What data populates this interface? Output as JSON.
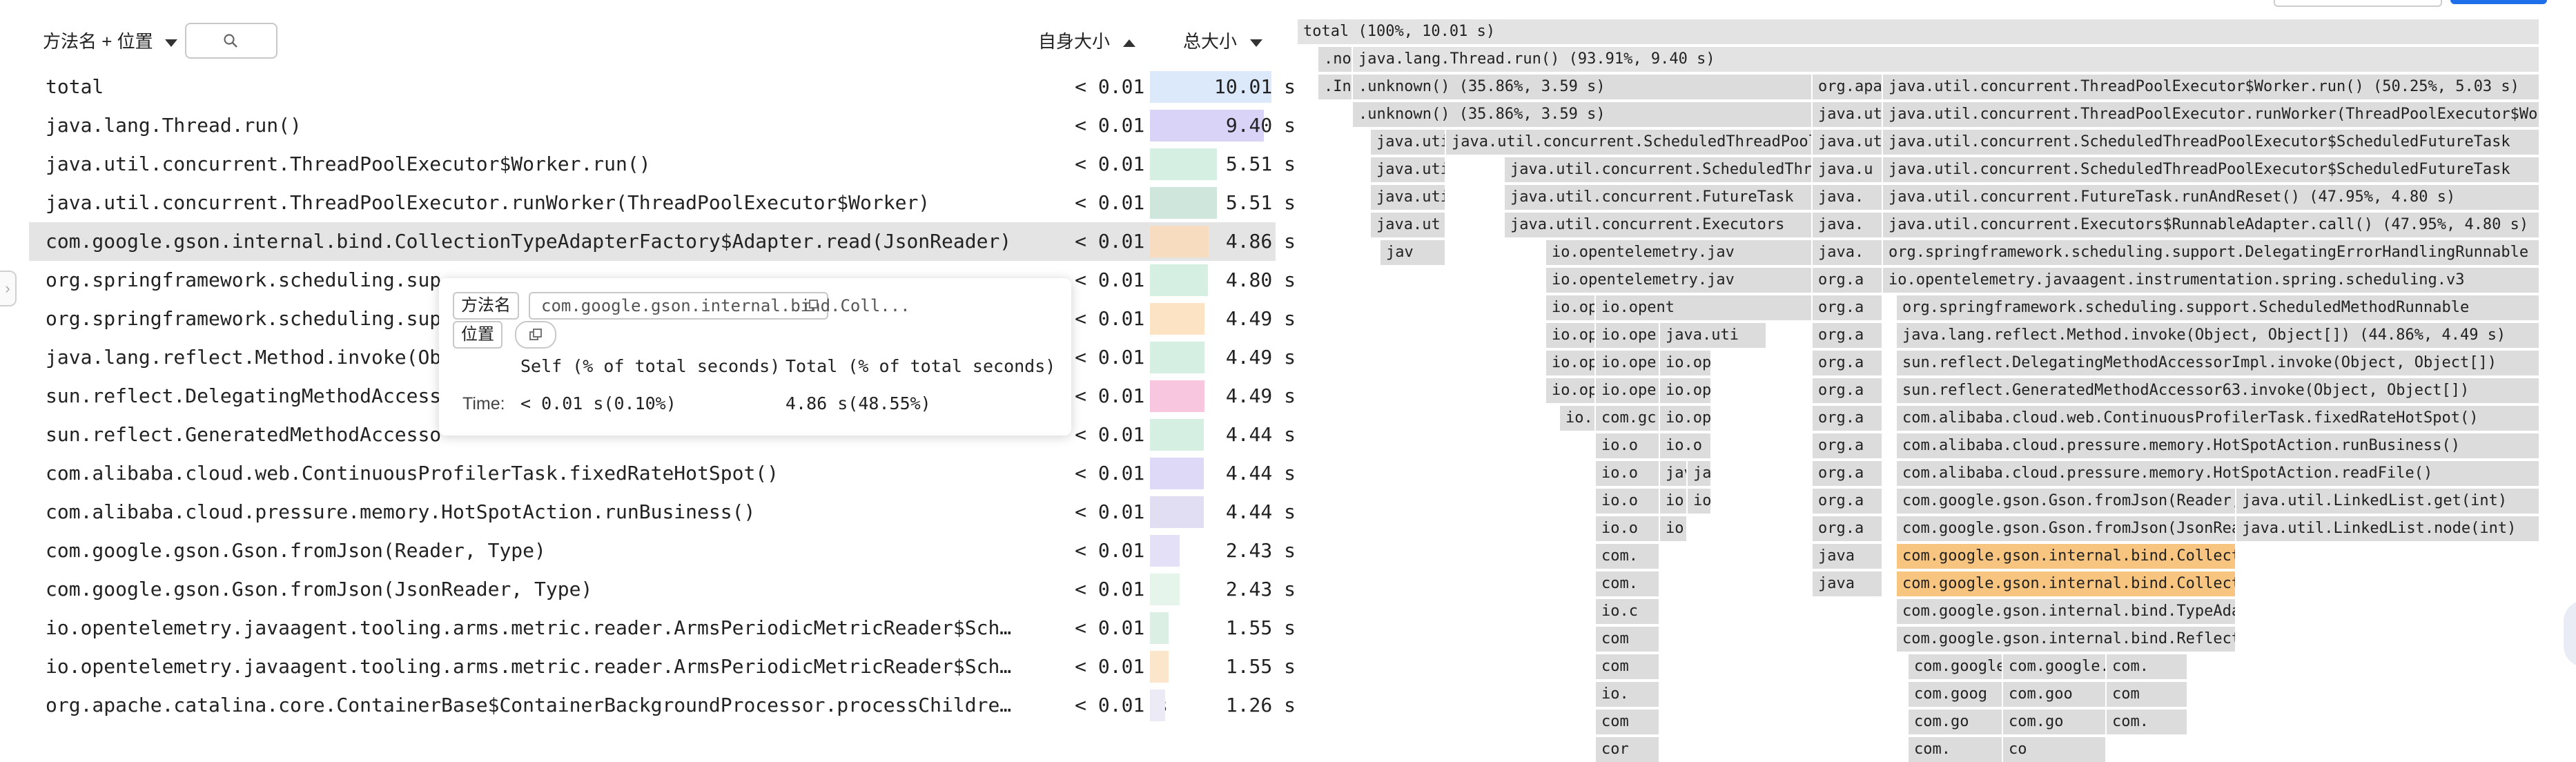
{
  "header": {
    "method_col_label": "方法名 + 位置",
    "self_col_label": "自身大小",
    "total_col_label": "总大小"
  },
  "rows": [
    {
      "name": "total",
      "self": "< 0.01 s",
      "total": "10.01 s",
      "bar_color": "#dbe9fb",
      "fraction": 1.0
    },
    {
      "name": "java.lang.Thread.run()",
      "self": "< 0.01 s",
      "total": "9.40 s",
      "bar_color": "#d9d4f7",
      "fraction": 0.939
    },
    {
      "name": "java.util.concurrent.ThreadPoolExecutor$Worker.run()",
      "self": "< 0.01 s",
      "total": "5.51 s",
      "bar_color": "#d6efe3",
      "fraction": 0.55
    },
    {
      "name": "java.util.concurrent.ThreadPoolExecutor.runWorker(ThreadPoolExecutor$Worker)",
      "self": "< 0.01 s",
      "total": "5.51 s",
      "bar_color": "#cfe6dc",
      "fraction": 0.55
    },
    {
      "name": "com.google.gson.internal.bind.CollectionTypeAdapterFactory$Adapter.read(JsonReader)",
      "self": "< 0.01 s",
      "total": "4.86 s",
      "bar_color": "#f7dcc0",
      "fraction": 0.4855
    },
    {
      "name": "org.springframework.scheduling.sup",
      "self": "< 0.01 s",
      "total": "4.80 s",
      "bar_color": "#d6efe3",
      "fraction": 0.48
    },
    {
      "name": "org.springframework.scheduling.sup",
      "self": "< 0.01 s",
      "total": "4.49 s",
      "bar_color": "#fbe3c4",
      "fraction": 0.449
    },
    {
      "name": "java.lang.reflect.Method.invoke(Ob",
      "self": "< 0.01 s",
      "total": "4.49 s",
      "bar_color": "#d6efe3",
      "fraction": 0.449
    },
    {
      "name": "sun.reflect.DelegatingMethodAccess",
      "self": "< 0.01 s",
      "total": "4.49 s",
      "bar_color": "#f9c6df",
      "fraction": 0.449
    },
    {
      "name": "sun.reflect.GeneratedMethodAccesso",
      "self": "< 0.01 s",
      "total": "4.44 s",
      "bar_color": "#d6efe3",
      "fraction": 0.444
    },
    {
      "name": "com.alibaba.cloud.web.ContinuousProfilerTask.fixedRateHotSpot()",
      "self": "< 0.01 s",
      "total": "4.44 s",
      "bar_color": "#ddd9f7",
      "fraction": 0.444
    },
    {
      "name": "com.alibaba.cloud.pressure.memory.HotSpotAction.runBusiness()",
      "self": "< 0.01 s",
      "total": "4.44 s",
      "bar_color": "#e1def3",
      "fraction": 0.444
    },
    {
      "name": "com.google.gson.Gson.fromJson(Reader, Type)",
      "self": "< 0.01 s",
      "total": "2.43 s",
      "bar_color": "#e4e0f7",
      "fraction": 0.243
    },
    {
      "name": "com.google.gson.Gson.fromJson(JsonReader, Type)",
      "self": "< 0.01 s",
      "total": "2.43 s",
      "bar_color": "#e6f5ec",
      "fraction": 0.243
    },
    {
      "name": "io.opentelemetry.javaagent.tooling.arms.metric.reader.ArmsPeriodicMetricReader$Sch…",
      "self": "< 0.01 s",
      "total": "1.55 s",
      "bar_color": "#dbefe4",
      "fraction": 0.155
    },
    {
      "name": "io.opentelemetry.javaagent.tooling.arms.metric.reader.ArmsPeriodicMetricReader$Sch…",
      "self": "< 0.01 s",
      "total": "1.55 s",
      "bar_color": "#fbe6cc",
      "fraction": 0.155
    },
    {
      "name": "org.apache.catalina.core.ContainerBase$ContainerBackgroundProcessor.processChildre…",
      "self": "< 0.01 s",
      "total": "1.26 s",
      "bar_color": "#ecebf5",
      "fraction": 0.126
    }
  ],
  "tooltip": {
    "method_tag": "方法名",
    "method_value": "com.google.gson.internal.bind.Coll...",
    "location_tag": "位置",
    "col_self": "Self (% of total seconds)",
    "col_total": "Total (% of total seconds)",
    "row_label": "Time:",
    "self_value": "< 0.01 s(0.10%)",
    "total_value": "4.86 s(48.55%)"
  },
  "flame": {
    "frames": [
      {
        "l": 0,
        "r": 1800,
        "row": 0,
        "label": "total (100%, 10.01 s)",
        "c": "#e3e3e3"
      },
      {
        "l": 30,
        "r": 80,
        "row": 1,
        "label": ".no",
        "c": "#dcdcdc"
      },
      {
        "l": 80,
        "r": 1800,
        "row": 1,
        "label": "java.lang.Thread.run() (93.91%, 9.40 s)",
        "c": "#e3e3e3"
      },
      {
        "l": 30,
        "r": 80,
        "row": 2,
        "label": ".In",
        "c": "#dcdcdc"
      },
      {
        "l": 80,
        "r": 746,
        "row": 2,
        "label": ".unknown() (35.86%, 3.59 s)",
        "c": "#dcdcdc"
      },
      {
        "l": 746,
        "r": 848,
        "row": 2,
        "label": "org.apa",
        "c": "#dcdcdc"
      },
      {
        "l": 848,
        "r": 1800,
        "row": 2,
        "label": "java.util.concurrent.ThreadPoolExecutor$Worker.run() (50.25%, 5.03 s)",
        "c": "#dcdcdc"
      },
      {
        "l": 80,
        "r": 746,
        "row": 3,
        "label": ".unknown() (35.86%, 3.59 s)",
        "c": "#dcdcdc"
      },
      {
        "l": 746,
        "r": 848,
        "row": 3,
        "label": "java.ut",
        "c": "#dcdcdc"
      },
      {
        "l": 848,
        "r": 1800,
        "row": 3,
        "label": "java.util.concurrent.ThreadPoolExecutor.runWorker(ThreadPoolExecutor$Worker)",
        "c": "#dcdcdc"
      },
      {
        "l": 106,
        "r": 215,
        "row": 4,
        "label": "java.uti",
        "c": "#dcdcdc"
      },
      {
        "l": 215,
        "r": 746,
        "row": 4,
        "label": "java.util.concurrent.ScheduledThreadPoolExecutor",
        "c": "#dcdcdc"
      },
      {
        "l": 746,
        "r": 848,
        "row": 4,
        "label": "java.ut",
        "c": "#dcdcdc"
      },
      {
        "l": 848,
        "r": 1800,
        "row": 4,
        "label": "java.util.concurrent.ScheduledThreadPoolExecutor$ScheduledFutureTask",
        "c": "#dcdcdc"
      },
      {
        "l": 106,
        "r": 215,
        "row": 5,
        "label": "java.uti",
        "c": "#dcdcdc"
      },
      {
        "l": 300,
        "r": 746,
        "row": 5,
        "label": "java.util.concurrent.ScheduledThread",
        "c": "#dcdcdc"
      },
      {
        "l": 746,
        "r": 848,
        "row": 5,
        "label": "java.u",
        "c": "#dcdcdc"
      },
      {
        "l": 848,
        "r": 1800,
        "row": 5,
        "label": "java.util.concurrent.ScheduledThreadPoolExecutor$ScheduledFutureTask",
        "c": "#dcdcdc"
      },
      {
        "l": 106,
        "r": 215,
        "row": 6,
        "label": "java.uti",
        "c": "#dcdcdc"
      },
      {
        "l": 300,
        "r": 746,
        "row": 6,
        "label": "java.util.concurrent.FutureTask",
        "c": "#dcdcdc"
      },
      {
        "l": 746,
        "r": 848,
        "row": 6,
        "label": "java.",
        "c": "#dcdcdc"
      },
      {
        "l": 848,
        "r": 1800,
        "row": 6,
        "label": "java.util.concurrent.FutureTask.runAndReset() (47.95%, 4.80 s)",
        "c": "#dcdcdc"
      },
      {
        "l": 106,
        "r": 215,
        "row": 7,
        "label": "java.ut",
        "c": "#dcdcdc"
      },
      {
        "l": 300,
        "r": 746,
        "row": 7,
        "label": "java.util.concurrent.Executors",
        "c": "#dcdcdc"
      },
      {
        "l": 746,
        "r": 848,
        "row": 7,
        "label": "java.",
        "c": "#dcdcdc"
      },
      {
        "l": 848,
        "r": 1800,
        "row": 7,
        "label": "java.util.concurrent.Executors$RunnableAdapter.call() (47.95%, 4.80 s)",
        "c": "#dcdcdc"
      },
      {
        "l": 120,
        "r": 215,
        "row": 8,
        "label": "jav",
        "c": "#dcdcdc"
      },
      {
        "l": 360,
        "r": 746,
        "row": 8,
        "label": "io.opentelemetry.jav",
        "c": "#dcdcdc"
      },
      {
        "l": 746,
        "r": 848,
        "row": 8,
        "label": "java.",
        "c": "#dcdcdc"
      },
      {
        "l": 848,
        "r": 1800,
        "row": 8,
        "label": "org.springframework.scheduling.support.DelegatingErrorHandlingRunnable",
        "c": "#dcdcdc"
      },
      {
        "l": 360,
        "r": 746,
        "row": 9,
        "label": "io.opentelemetry.jav",
        "c": "#dcdcdc"
      },
      {
        "l": 746,
        "r": 848,
        "row": 9,
        "label": "org.a",
        "c": "#dcdcdc"
      },
      {
        "l": 848,
        "r": 1800,
        "row": 9,
        "label": "io.opentelemetry.javaagent.instrumentation.spring.scheduling.v3",
        "c": "#dcdcdc"
      },
      {
        "l": 360,
        "r": 432,
        "row": 10,
        "label": "io.op",
        "c": "#dcdcdc"
      },
      {
        "l": 432,
        "r": 746,
        "row": 10,
        "label": "io.opent",
        "c": "#dcdcdc"
      },
      {
        "l": 746,
        "r": 848,
        "row": 10,
        "label": "org.a",
        "c": "#dcdcdc"
      },
      {
        "l": 868,
        "r": 1800,
        "row": 10,
        "label": "org.springframework.scheduling.support.ScheduledMethodRunnable",
        "c": "#dcdcdc"
      },
      {
        "l": 360,
        "r": 432,
        "row": 11,
        "label": "io.op",
        "c": "#dcdcdc"
      },
      {
        "l": 432,
        "r": 525,
        "row": 11,
        "label": "io.oper",
        "c": "#dcdcdc"
      },
      {
        "l": 525,
        "r": 680,
        "row": 11,
        "label": "java.uti",
        "c": "#dcdcdc"
      },
      {
        "l": 746,
        "r": 848,
        "row": 11,
        "label": "org.a",
        "c": "#dcdcdc"
      },
      {
        "l": 868,
        "r": 1800,
        "row": 11,
        "label": "java.lang.reflect.Method.invoke(Object, Object[]) (44.86%, 4.49 s)",
        "c": "#dcdcdc"
      },
      {
        "l": 360,
        "r": 432,
        "row": 12,
        "label": "io.op",
        "c": "#dcdcdc"
      },
      {
        "l": 432,
        "r": 525,
        "row": 12,
        "label": "io.ope",
        "c": "#dcdcdc"
      },
      {
        "l": 525,
        "r": 600,
        "row": 12,
        "label": "io.op",
        "c": "#dcdcdc"
      },
      {
        "l": 746,
        "r": 848,
        "row": 12,
        "label": "org.a",
        "c": "#dcdcdc"
      },
      {
        "l": 868,
        "r": 1800,
        "row": 12,
        "label": "sun.reflect.DelegatingMethodAccessorImpl.invoke(Object, Object[])",
        "c": "#dcdcdc"
      },
      {
        "l": 360,
        "r": 432,
        "row": 13,
        "label": "io.op",
        "c": "#dcdcdc"
      },
      {
        "l": 432,
        "r": 525,
        "row": 13,
        "label": "io.ope",
        "c": "#dcdcdc"
      },
      {
        "l": 525,
        "r": 600,
        "row": 13,
        "label": "io.op",
        "c": "#dcdcdc"
      },
      {
        "l": 746,
        "r": 848,
        "row": 13,
        "label": "org.a",
        "c": "#dcdcdc"
      },
      {
        "l": 868,
        "r": 1800,
        "row": 13,
        "label": "sun.reflect.GeneratedMethodAccessor63.invoke(Object, Object[])",
        "c": "#dcdcdc"
      },
      {
        "l": 380,
        "r": 432,
        "row": 14,
        "label": "io.",
        "c": "#dcdcdc"
      },
      {
        "l": 432,
        "r": 525,
        "row": 14,
        "label": "com.gc",
        "c": "#dcdcdc"
      },
      {
        "l": 525,
        "r": 600,
        "row": 14,
        "label": "io.op",
        "c": "#dcdcdc"
      },
      {
        "l": 746,
        "r": 848,
        "row": 14,
        "label": "org.a",
        "c": "#dcdcdc"
      },
      {
        "l": 868,
        "r": 1800,
        "row": 14,
        "label": "com.alibaba.cloud.web.ContinuousProfilerTask.fixedRateHotSpot()",
        "c": "#dcdcdc"
      },
      {
        "l": 432,
        "r": 525,
        "row": 15,
        "label": "io.o",
        "c": "#dcdcdc"
      },
      {
        "l": 525,
        "r": 600,
        "row": 15,
        "label": "io.o",
        "c": "#dcdcdc"
      },
      {
        "l": 746,
        "r": 848,
        "row": 15,
        "label": "org.a",
        "c": "#dcdcdc"
      },
      {
        "l": 868,
        "r": 1800,
        "row": 15,
        "label": "com.alibaba.cloud.pressure.memory.HotSpotAction.runBusiness()",
        "c": "#dcdcdc"
      },
      {
        "l": 432,
        "r": 525,
        "row": 16,
        "label": "io.o",
        "c": "#dcdcdc"
      },
      {
        "l": 525,
        "r": 565,
        "row": 16,
        "label": "java",
        "c": "#dcdcdc"
      },
      {
        "l": 565,
        "r": 600,
        "row": 16,
        "label": "jav",
        "c": "#dcdcdc"
      },
      {
        "l": 746,
        "r": 848,
        "row": 16,
        "label": "org.a",
        "c": "#dcdcdc"
      },
      {
        "l": 868,
        "r": 1800,
        "row": 16,
        "label": "com.alibaba.cloud.pressure.memory.HotSpotAction.readFile()",
        "c": "#dcdcdc"
      },
      {
        "l": 432,
        "r": 525,
        "row": 17,
        "label": "io.o",
        "c": "#dcdcdc"
      },
      {
        "l": 525,
        "r": 565,
        "row": 17,
        "label": "io.o",
        "c": "#dcdcdc"
      },
      {
        "l": 565,
        "r": 600,
        "row": 17,
        "label": "io.",
        "c": "#dcdcdc"
      },
      {
        "l": 746,
        "r": 848,
        "row": 17,
        "label": "org.a",
        "c": "#dcdcdc"
      },
      {
        "l": 868,
        "r": 1360,
        "row": 17,
        "label": "com.google.gson.Gson.fromJson(Reader, Type)",
        "c": "#dcdcdc"
      },
      {
        "l": 1360,
        "r": 1800,
        "row": 17,
        "label": "java.util.LinkedList.get(int)",
        "c": "#dcdcdc"
      },
      {
        "l": 432,
        "r": 525,
        "row": 18,
        "label": "io.o",
        "c": "#dcdcdc"
      },
      {
        "l": 525,
        "r": 565,
        "row": 18,
        "label": "io.c",
        "c": "#dcdcdc"
      },
      {
        "l": 746,
        "r": 848,
        "row": 18,
        "label": "org.a",
        "c": "#dcdcdc"
      },
      {
        "l": 868,
        "r": 1360,
        "row": 18,
        "label": "com.google.gson.Gson.fromJson(JsonReader, Type)",
        "c": "#dcdcdc"
      },
      {
        "l": 1360,
        "r": 1800,
        "row": 18,
        "label": "java.util.LinkedList.node(int)",
        "c": "#dcdcdc"
      },
      {
        "l": 432,
        "r": 525,
        "row": 19,
        "label": "com.",
        "c": "#dcdcdc"
      },
      {
        "l": 746,
        "r": 848,
        "row": 19,
        "label": "java",
        "c": "#dcdcdc"
      },
      {
        "l": 868,
        "r": 1360,
        "row": 19,
        "label": "com.google.gson.internal.bind.CollectionTypeAdapterFactory",
        "c": "#f7c580"
      },
      {
        "l": 432,
        "r": 525,
        "row": 20,
        "label": "com.",
        "c": "#dcdcdc"
      },
      {
        "l": 746,
        "r": 848,
        "row": 20,
        "label": "java",
        "c": "#dcdcdc"
      },
      {
        "l": 868,
        "r": 1360,
        "row": 20,
        "label": "com.google.gson.internal.bind.CollectionTypeAdapterFactory",
        "c": "#f7c580"
      },
      {
        "l": 432,
        "r": 525,
        "row": 21,
        "label": "io.c",
        "c": "#dcdcdc"
      },
      {
        "l": 868,
        "r": 1360,
        "row": 21,
        "label": "com.google.gson.internal.bind.TypeAdapters",
        "c": "#dcdcdc"
      },
      {
        "l": 432,
        "r": 525,
        "row": 22,
        "label": "com",
        "c": "#dcdcdc"
      },
      {
        "l": 868,
        "r": 1360,
        "row": 22,
        "label": "com.google.gson.internal.bind.ReflectiveTypeAdapterFactory",
        "c": "#dcdcdc"
      },
      {
        "l": 432,
        "r": 525,
        "row": 23,
        "label": "com",
        "c": "#dcdcdc"
      },
      {
        "l": 885,
        "r": 1022,
        "row": 23,
        "label": "com.google.gson",
        "c": "#dcdcdc"
      },
      {
        "l": 1022,
        "r": 1172,
        "row": 23,
        "label": "com.google.g",
        "c": "#dcdcdc"
      },
      {
        "l": 1172,
        "r": 1290,
        "row": 23,
        "label": "com.",
        "c": "#dcdcdc"
      },
      {
        "l": 432,
        "r": 525,
        "row": 24,
        "label": "io.",
        "c": "#dcdcdc"
      },
      {
        "l": 885,
        "r": 1022,
        "row": 24,
        "label": "com.goog",
        "c": "#dcdcdc"
      },
      {
        "l": 1022,
        "r": 1172,
        "row": 24,
        "label": "com.goo",
        "c": "#dcdcdc"
      },
      {
        "l": 1172,
        "r": 1290,
        "row": 24,
        "label": "com",
        "c": "#dcdcdc"
      },
      {
        "l": 432,
        "r": 525,
        "row": 25,
        "label": "com",
        "c": "#dcdcdc"
      },
      {
        "l": 885,
        "r": 1022,
        "row": 25,
        "label": "com.go",
        "c": "#dcdcdc"
      },
      {
        "l": 1022,
        "r": 1172,
        "row": 25,
        "label": "com.go",
        "c": "#dcdcdc"
      },
      {
        "l": 1172,
        "r": 1290,
        "row": 25,
        "label": "com.",
        "c": "#dcdcdc"
      },
      {
        "l": 432,
        "r": 525,
        "row": 26,
        "label": "cor",
        "c": "#dcdcdc"
      },
      {
        "l": 885,
        "r": 1022,
        "row": 26,
        "label": "com.",
        "c": "#dcdcdc"
      },
      {
        "l": 1022,
        "r": 1172,
        "row": 26,
        "label": "co",
        "c": "#dcdcdc"
      }
    ]
  }
}
